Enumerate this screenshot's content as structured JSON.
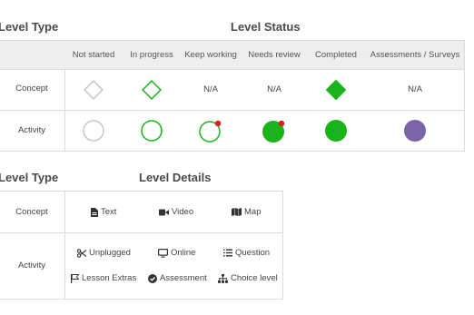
{
  "status_section": {
    "level_type_heading": "Level Type",
    "level_status_heading": "Level Status",
    "columns": [
      "Not started",
      "In progress",
      "Keep working",
      "Needs review",
      "Completed",
      "Assessments / Surveys"
    ],
    "rows": [
      {
        "label": "Concept",
        "cells": [
          "diamond-empty",
          "diamond-green-outline",
          "N/A",
          "N/A",
          "diamond-green-filled",
          "N/A"
        ]
      },
      {
        "label": "Activity",
        "cells": [
          "circle-empty",
          "circle-green-outline",
          "circle-green-outline-red-dot",
          "circle-green-filled-red-dot",
          "circle-green-filled",
          "circle-purple-filled"
        ]
      }
    ],
    "na_text": "N/A"
  },
  "details_section": {
    "level_type_heading": "Level Type",
    "level_details_heading": "Level Details",
    "concept_label": "Concept",
    "activity_label": "Activity",
    "concept_items": [
      {
        "label": "Text",
        "icon": "document-icon"
      },
      {
        "label": "Video",
        "icon": "video-camera-icon"
      },
      {
        "label": "Map",
        "icon": "map-icon"
      }
    ],
    "activity_items": [
      {
        "label": "Unplugged",
        "icon": "scissors-icon"
      },
      {
        "label": "Online",
        "icon": "monitor-icon"
      },
      {
        "label": "Question",
        "icon": "list-icon"
      },
      {
        "label": "Lesson Extras",
        "icon": "flag-icon"
      },
      {
        "label": "Assessment",
        "icon": "check-circle-icon"
      },
      {
        "label": "Choice level",
        "icon": "sitemap-icon"
      }
    ]
  },
  "colors": {
    "green": "#1bb31b",
    "red": "#e01919",
    "purple": "#7a64a8",
    "grey_outline": "#c6c6c6",
    "header_bg": "#eeeeee"
  }
}
